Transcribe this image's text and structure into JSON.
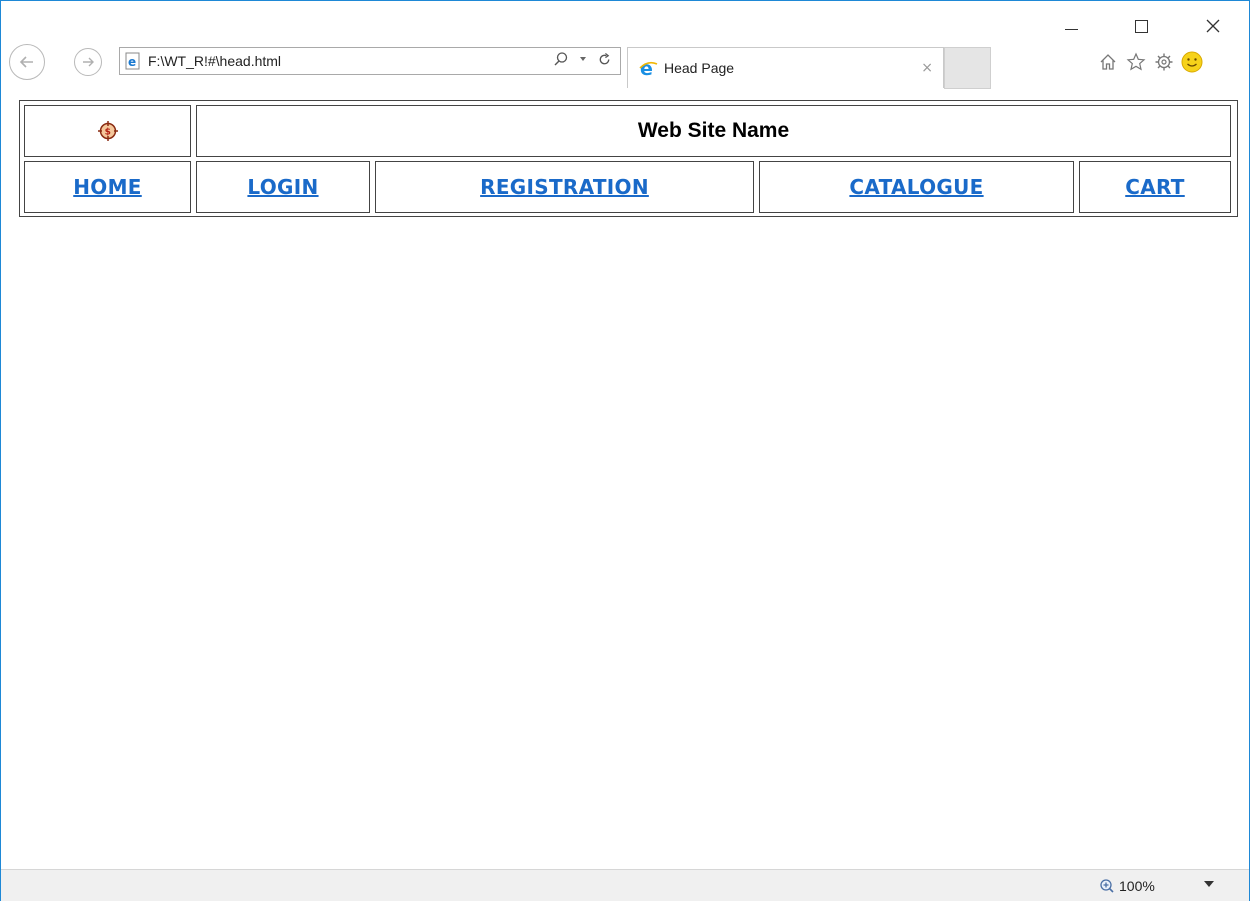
{
  "browser": {
    "address": "F:\\WT_R!#\\head.html",
    "tab_title": "Head Page",
    "tab_close": "×",
    "zoom": "100%",
    "close_glyph": "✕",
    "icons": [
      "back-arrow-icon",
      "forward-arrow-icon",
      "ie-page-icon",
      "search-icon",
      "dropdown-icon",
      "refresh-icon",
      "ie-logo-icon",
      "home-icon",
      "star-icon",
      "gear-icon",
      "smiley-icon",
      "zoom-icon"
    ]
  },
  "page": {
    "site_name": "Web Site Name",
    "nav": [
      {
        "label": "HOME"
      },
      {
        "label": "LOGIN"
      },
      {
        "label": "REGISTRATION"
      },
      {
        "label": "CATALOGUE"
      },
      {
        "label": "CART"
      }
    ]
  },
  "colors": {
    "link": "#1a6ac9",
    "window_border": "#1e88d6"
  }
}
